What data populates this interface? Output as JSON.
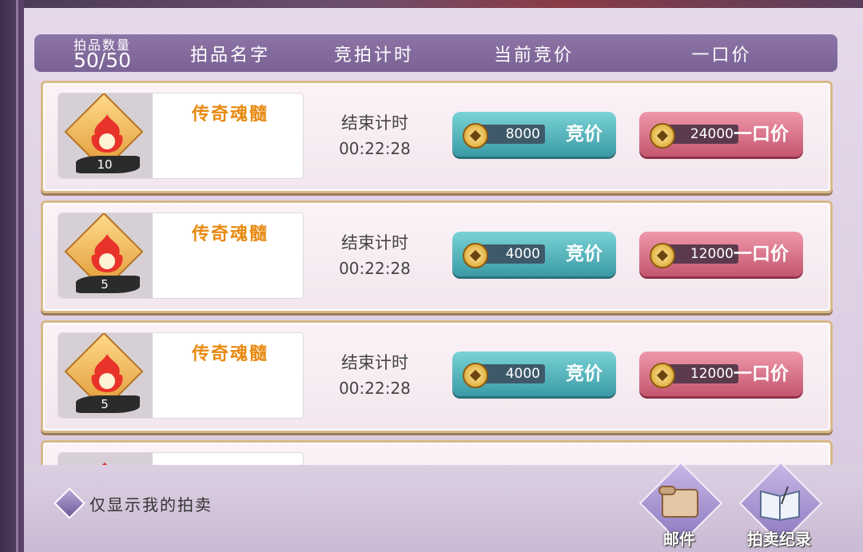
{
  "header": {
    "count_label": "拍品数量",
    "count_value": "50/50",
    "col_name": "拍品名字",
    "col_timer": "竞拍计时",
    "col_current_bid": "当前竞价",
    "col_buyout": "一口价"
  },
  "items": [
    {
      "name": "传奇魂髓",
      "qty": "10",
      "timer_label": "结束计时",
      "timer": "00:22:28",
      "bid_price": "8000",
      "bid_label": "竞价",
      "buyout_price": "24000",
      "buyout_label": "一口价"
    },
    {
      "name": "传奇魂髓",
      "qty": "5",
      "timer_label": "结束计时",
      "timer": "00:22:28",
      "bid_price": "4000",
      "bid_label": "竞价",
      "buyout_price": "12000",
      "buyout_label": "一口价"
    },
    {
      "name": "传奇魂髓",
      "qty": "5",
      "timer_label": "结束计时",
      "timer": "00:22:28",
      "bid_price": "4000",
      "bid_label": "竞价",
      "buyout_price": "12000",
      "buyout_label": "一口价"
    }
  ],
  "footer": {
    "toggle_label": "仅显示我的拍卖",
    "mail_label": "邮件",
    "records_label": "拍卖纪录"
  },
  "colors": {
    "header_bg": "#8d74a6",
    "item_name": "#e88a12",
    "bid_button": "#4fb3bb",
    "buyout_button": "#d96f86"
  }
}
